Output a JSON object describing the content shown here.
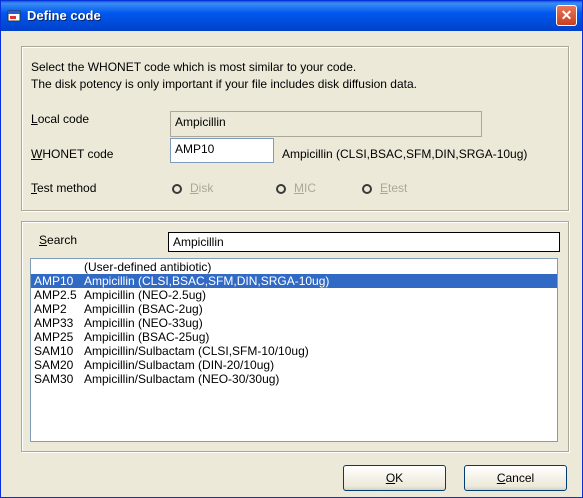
{
  "window": {
    "title": "Define code",
    "close_label": "✕"
  },
  "instructions": {
    "line1": "Select the WHONET code which is most similar to your code.",
    "line2": "The disk potency is only important if your file includes disk diffusion data."
  },
  "local_code": {
    "label_key": "L",
    "label_rest": "ocal code",
    "value": "Ampicillin"
  },
  "whonet_code": {
    "label_key": "W",
    "label_rest": "HONET code",
    "value": "AMP10",
    "description": "Ampicillin (CLSI,BSAC,SFM,DIN,SRGA-10ug)"
  },
  "test_method": {
    "label_key": "T",
    "label_rest": "est method",
    "options": [
      {
        "key": "D",
        "rest": "isk"
      },
      {
        "key": "M",
        "rest": "IC"
      },
      {
        "key": "E",
        "rest": "test"
      }
    ]
  },
  "search": {
    "label_key": "S",
    "label_rest": "earch",
    "value": "Ampicillin"
  },
  "list": {
    "items": [
      {
        "code": "",
        "name": "(User-defined antibiotic)"
      },
      {
        "code": "AMP10",
        "name": "Ampicillin (CLSI,BSAC,SFM,DIN,SRGA-10ug)",
        "selected": true
      },
      {
        "code": "AMP2.5",
        "name": "Ampicillin (NEO-2.5ug)"
      },
      {
        "code": "AMP2",
        "name": "Ampicillin (BSAC-2ug)"
      },
      {
        "code": "AMP33",
        "name": "Ampicillin (NEO-33ug)"
      },
      {
        "code": "AMP25",
        "name": "Ampicillin (BSAC-25ug)"
      },
      {
        "code": "SAM10",
        "name": "Ampicillin/Sulbactam (CLSI,SFM-10/10ug)"
      },
      {
        "code": "SAM20",
        "name": "Ampicillin/Sulbactam (DIN-20/10ug)"
      },
      {
        "code": "SAM30",
        "name": "Ampicillin/Sulbactam (NEO-30/30ug)"
      }
    ]
  },
  "buttons": {
    "ok": {
      "key": "O",
      "rest": "K"
    },
    "cancel": {
      "key": "C",
      "rest": "ancel"
    }
  },
  "colors": {
    "titlebar": "#0058ee",
    "selection": "#316ac5",
    "face": "#ece9d8"
  }
}
